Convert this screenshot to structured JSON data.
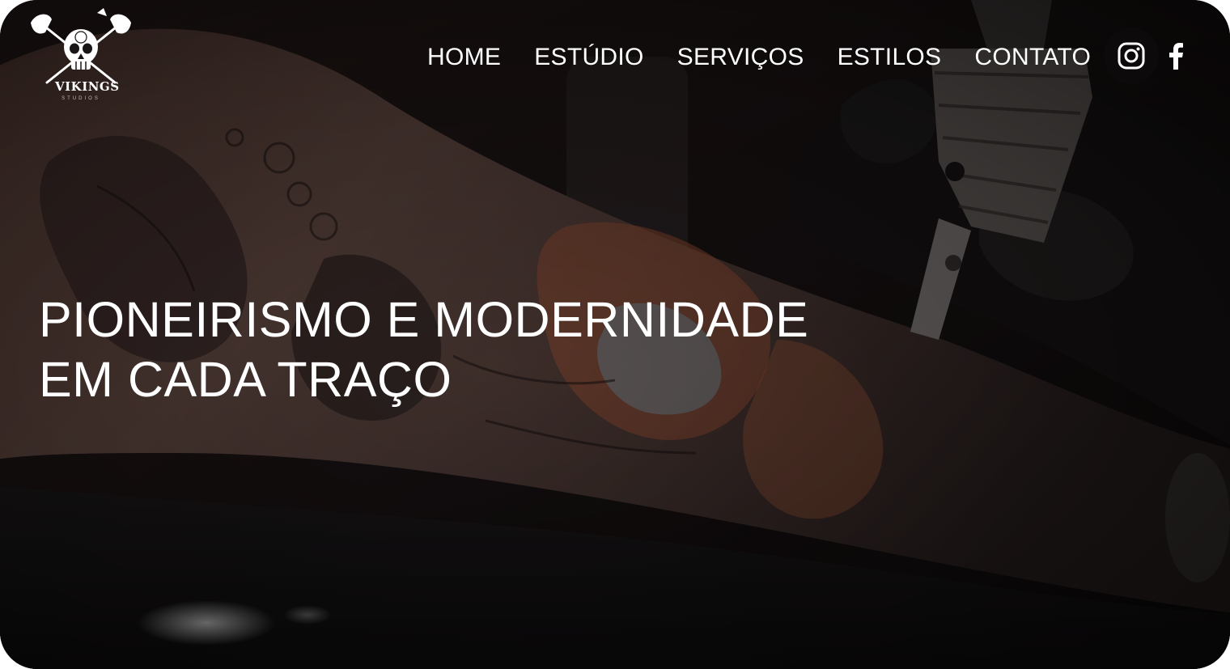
{
  "brand": {
    "logo_icon": "viking-skull-axes-icon",
    "name": "VIKINGS",
    "tagline": "STUDIOS"
  },
  "nav": {
    "items": [
      {
        "label": "HOME"
      },
      {
        "label": "ESTÚDIO"
      },
      {
        "label": "SERVIÇOS"
      },
      {
        "label": "ESTILOS"
      },
      {
        "label": "CONTATO"
      }
    ]
  },
  "social": {
    "instagram_icon": "instagram-icon",
    "facebook_icon": "facebook-icon"
  },
  "hero": {
    "headline_line1": "PIONEIRISMO E MODERNIDADE",
    "headline_line2": "EM CADA TRAÇO",
    "background_image": "tattoo-artist-working-on-arm-photo"
  },
  "colors": {
    "text": "#ffffff",
    "background": "#141012",
    "accent_skin": "#6a4a3e"
  }
}
